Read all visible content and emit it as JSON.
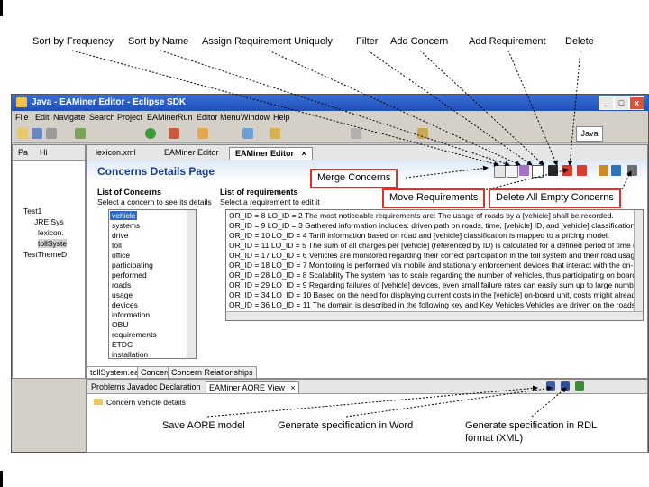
{
  "callouts": {
    "sort_frequency": "Sort by Frequency",
    "sort_name": "Sort by Name",
    "assign_requirement": "Assign Requirement Uniquely",
    "filter": "Filter",
    "add_concern": "Add Concern",
    "add_requirement": "Add Requirement",
    "delete": "Delete",
    "merge_concerns": "Merge Concerns",
    "move_requirements": "Move Requirements",
    "delete_all_empty": "Delete All Empty Concerns",
    "save_aore": "Save AORE model",
    "generate_word": "Generate specification in Word",
    "generate_rdl_line1": "Generate specification in RDL",
    "generate_rdl_line2": "format (XML)"
  },
  "window": {
    "title": "Java - EAMiner Editor - Eclipse SDK",
    "perspective": "Java",
    "min": "_",
    "max": "□",
    "close": "x"
  },
  "menubar": [
    "File",
    "Edit",
    "Navigate",
    "Search",
    "Project",
    "EAMiner",
    "Run",
    "Editor Menu",
    "Window",
    "Help"
  ],
  "left_pane": {
    "tabs": [
      "Pa",
      "Hi"
    ],
    "tree": [
      "Test1",
      "JRE Sys",
      "lexicon.",
      "tollSyste",
      "TestThemeD"
    ]
  },
  "editor": {
    "tabs": [
      "lexicon.xml",
      "EAMiner Editor",
      "EAMiner Editor"
    ],
    "active_close": "×",
    "page_title": "Concerns Details Page",
    "concerns": {
      "title": "List of Concerns",
      "desc": "Select a concern to see its details",
      "items": [
        "vehicle",
        "systems",
        "drive",
        "toll",
        "office",
        "participating",
        "performed",
        "roads",
        "usage",
        "devices",
        "information",
        "OBU",
        "requirements",
        "ETDC",
        "installation"
      ],
      "selected_index": 0
    },
    "requirements": {
      "title": "List of requirements",
      "desc": "Select a requirement to edit it",
      "items": [
        "OR_ID = 8 LO_ID = 2 The most noticeable requirements are: The usage of roads by a [vehicle] shall be recorded.",
        "OR_ID = 9 LO_ID = 3 Gathered information includes: driven path on roads, time, [vehicle] ID, and [vehicle] classification.",
        "OR_ID = 10 LO_ID = 4 Tariff information based on road and [vehicle] classification is mapped to a pricing model.",
        "OR_ID = 11 LO_ID = 5 The sum of all charges per [vehicle] (referenced by ID) is calculated for a defined period of time (e.g",
        "OR_ID = 17 LO_ID = 6 Vehicles are monitored regarding their correct participation in the toll system and their road usage.",
        "OR_ID = 18 LO_ID = 7 Monitoring is performed via mobile and stationary enforcement devices that interact with the on-boa",
        "OR_ID = 28 LO_ID = 8 Scalability The system has to scale regarding the number of vehicles, thus participating on board uni",
        "OR_ID = 29 LO_ID = 9 Regarding failures of [vehicle] devices, even small failure rates can easily sum up to large numbers, d",
        "OR_ID = 34 LO_ID = 10 Based on the need for displaying current costs in the [vehicle] on-board unit, costs might already b",
        "OR_ID = 36 LO_ID = 11 The domain is described in the following key and Key Vehicles Vehicles are driven on the roads"
      ]
    },
    "footer_tabs": [
      "tollSystem.ea",
      "Concerns",
      "Concern Relationships"
    ]
  },
  "bottom": {
    "tabs": [
      "Problems",
      "Javadoc",
      "Declaration",
      "EAMiner AORE View"
    ],
    "active_close": "×",
    "tree_item": "Concern vehicle details"
  },
  "colors": {
    "callout_border": "#e0302a",
    "title_blue": "#1a3d8a",
    "selection": "#316ac5"
  }
}
